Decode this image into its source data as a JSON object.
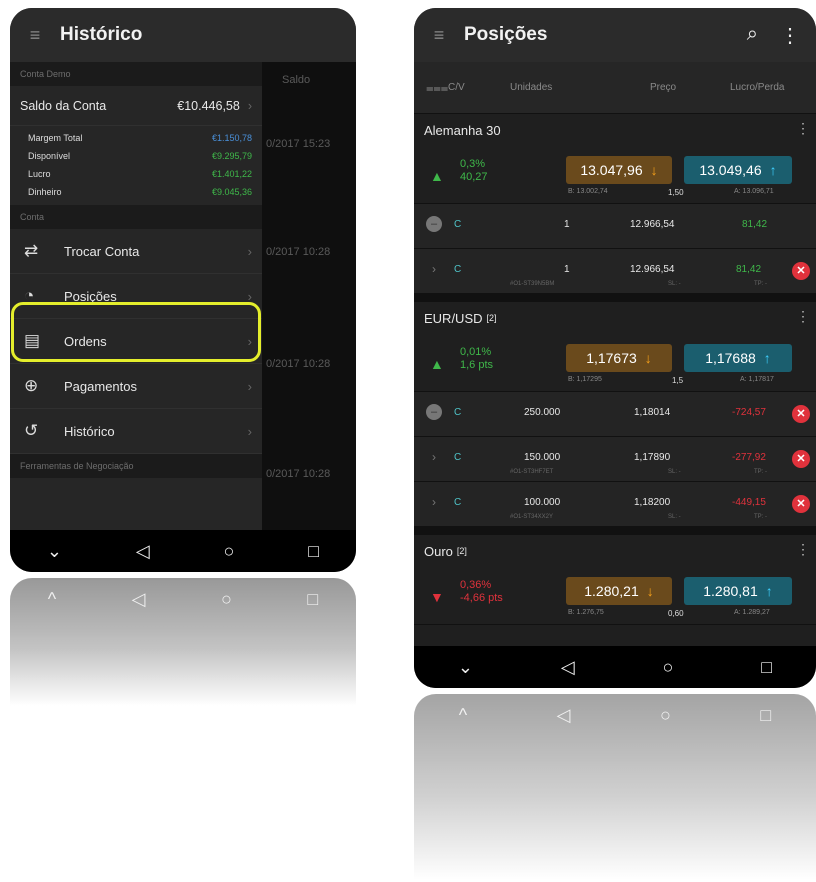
{
  "left": {
    "title": "Histórico",
    "conta_demo_header": "Conta Demo",
    "saldo_label": "Saldo da Conta",
    "saldo_value": "€10.446,58",
    "rows": [
      {
        "label": "Margem Total",
        "value": "€1.150,78",
        "color": "#4a90d9"
      },
      {
        "label": "Disponível",
        "value": "€9.295,79",
        "color": "#3fb84a"
      },
      {
        "label": "Lucro",
        "value": "€1.401,22",
        "color": "#3fb84a"
      },
      {
        "label": "Dinheiro",
        "value": "€9.045,36",
        "color": "#3fb84a"
      }
    ],
    "conta_header": "Conta",
    "menu": [
      {
        "label": "Trocar Conta",
        "icon": "swap-icon"
      },
      {
        "label": "Posições",
        "icon": "pie-chart-icon"
      },
      {
        "label": "Ordens",
        "icon": "document-icon"
      },
      {
        "label": "Pagamentos",
        "icon": "currency-icon"
      },
      {
        "label": "Histórico",
        "icon": "history-icon"
      }
    ],
    "tools_header": "Ferramentas de Negociação",
    "dim_header": "Saldo",
    "dim_timestamps": [
      "0/2017 15:23",
      "0/2017 10:28",
      "0/2017 10:28",
      "0/2017 10:28"
    ]
  },
  "right": {
    "title": "Posições",
    "columns": {
      "cv": "C/V",
      "units": "Unidades",
      "price": "Preço",
      "pl": "Lucro/Perda"
    },
    "instruments": [
      {
        "name": "Alemanha 30",
        "change_pct": "0,3%",
        "change_abs": "40,27",
        "direction": "up",
        "sell": "13.047,96",
        "buy": "13.049,46",
        "low": "B: 13.002,74",
        "spread": "1,50",
        "high": "A: 13.096,71",
        "positions": [
          {
            "side": "C",
            "units": "1",
            "price": "12.966,54",
            "pl": "81,42",
            "pl_color": "#3fb84a",
            "kind": "summary"
          },
          {
            "side": "C",
            "units": "1",
            "price": "12.966,54",
            "pl": "81,42",
            "pl_color": "#3fb84a",
            "kind": "detail",
            "id": "#O1-ST39N5BM",
            "sl": "SL: -",
            "tp": "TP: -"
          }
        ]
      },
      {
        "name": "EUR/USD",
        "count": "[2]",
        "change_pct": "0,01%",
        "change_abs": "1,6 pts",
        "direction": "up",
        "sell": "1,17673",
        "buy": "1,17688",
        "low": "B: 1,17295",
        "spread": "1,5",
        "high": "A: 1,17817",
        "positions": [
          {
            "side": "C",
            "units": "250.000",
            "price": "1,18014",
            "pl": "-724,57",
            "pl_color": "#e0323c",
            "kind": "summary"
          },
          {
            "side": "C",
            "units": "150.000",
            "price": "1,17890",
            "pl": "-277,92",
            "pl_color": "#e0323c",
            "kind": "detail",
            "id": "#O1-ST3HF7ET",
            "sl": "SL: -",
            "tp": "TP: -"
          },
          {
            "side": "C",
            "units": "100.000",
            "price": "1,18200",
            "pl": "-449,15",
            "pl_color": "#e0323c",
            "kind": "detail",
            "id": "#O1-ST34XX2Y",
            "sl": "SL: -",
            "tp": "TP: -"
          }
        ]
      },
      {
        "name": "Ouro",
        "count": "[2]",
        "change_pct": "0,36%",
        "change_abs": "-4,66 pts",
        "direction": "down",
        "sell": "1.280,21",
        "buy": "1.280,81",
        "low": "B: 1.276,75",
        "spread": "0,60",
        "high": "A: 1.289,27"
      }
    ]
  },
  "nav": {
    "back": "◁",
    "home": "○",
    "recents": "□",
    "down": "⌄"
  },
  "colors": {
    "up": "#3fb84a",
    "down": "#e0323c",
    "highlight": "#e4ee2c"
  }
}
